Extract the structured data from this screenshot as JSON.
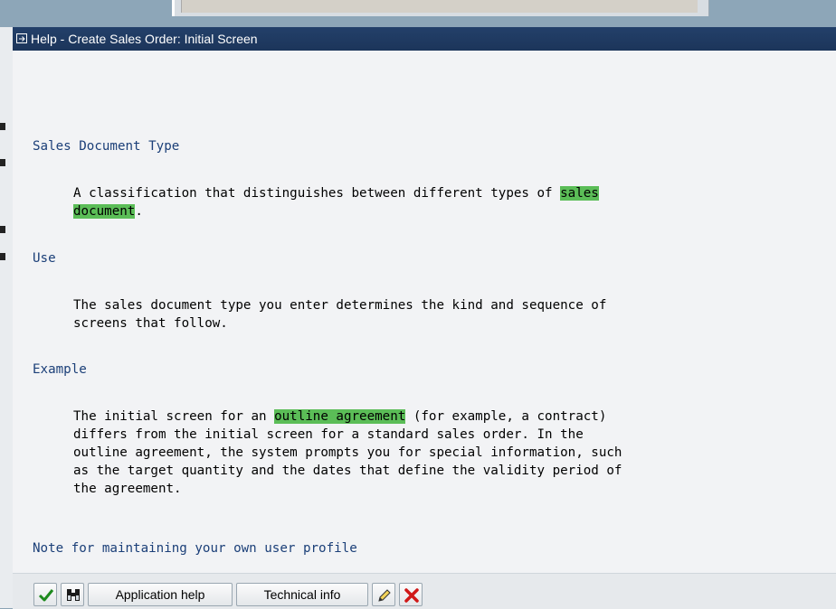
{
  "window": {
    "title": "Help - Create Sales Order: Initial Screen"
  },
  "content": {
    "sections": [
      {
        "heading": "Sales Document Type",
        "lines": [
          {
            "before": "A classification that distinguishes between different types of ",
            "highlight": "sales",
            "after": ""
          },
          {
            "before": "",
            "highlight": "document",
            "after": "."
          }
        ]
      },
      {
        "heading": "Use",
        "lines": [
          {
            "before": "The sales document type you enter determines the kind and sequence of",
            "highlight": "",
            "after": ""
          },
          {
            "before": "screens that follow.",
            "highlight": "",
            "after": ""
          }
        ]
      },
      {
        "heading": "Example",
        "lines": [
          {
            "before": "The initial screen for an ",
            "highlight": "outline agreement",
            "after": " (for example, a contract)"
          },
          {
            "before": "differs from the initial screen for a standard sales order. In the",
            "highlight": "",
            "after": ""
          },
          {
            "before": "outline agreement, the system prompts you for special information, such",
            "highlight": "",
            "after": ""
          },
          {
            "before": "as the target quantity and the dates that define the validity period of",
            "highlight": "",
            "after": ""
          },
          {
            "before": "the agreement.",
            "highlight": "",
            "after": ""
          }
        ]
      }
    ],
    "footer_link": "Note for maintaining your own user profile"
  },
  "toolbar": {
    "continue_icon": "checkmark-icon",
    "find_icon": "binoculars-icon",
    "application_help_label": "Application help",
    "technical_info_label": "Technical info",
    "edit_icon": "pencil-icon",
    "cancel_icon": "cancel-x-icon"
  },
  "colors": {
    "titlebar": "#1f3a62",
    "heading": "#1b3f78",
    "highlight": "#5bbd57",
    "cancel": "#d01818",
    "confirm": "#1e8a1e"
  }
}
